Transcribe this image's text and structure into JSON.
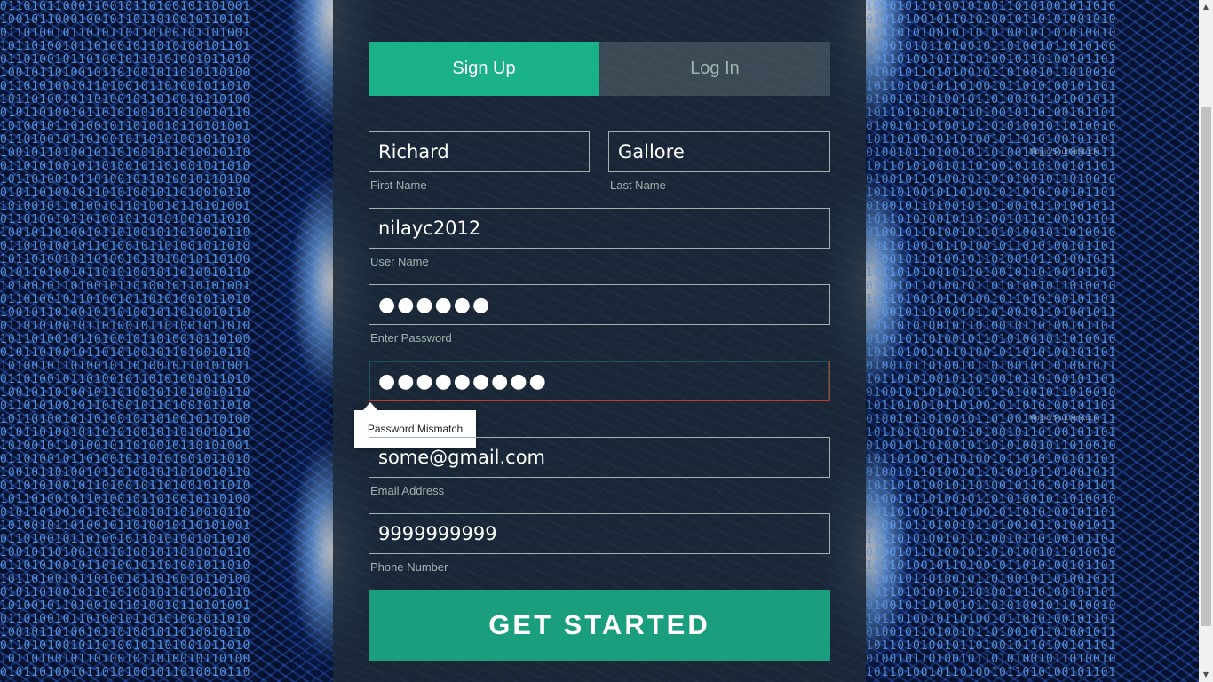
{
  "tabs": [
    {
      "label": "Sign Up",
      "active": true
    },
    {
      "label": "Log In",
      "active": false
    }
  ],
  "fields": {
    "first_name": {
      "value": "Richard",
      "label": "First Name"
    },
    "last_name": {
      "value": "Gallore",
      "label": "Last Name"
    },
    "user_name": {
      "value": "nilayc2012",
      "label": "User Name"
    },
    "password": {
      "value": "●●●●●●",
      "label": "Enter Password"
    },
    "confirm_password": {
      "value": "●●●●●●●●●"
    },
    "email": {
      "value": "some@gmail.com",
      "label": "Email Address"
    },
    "phone": {
      "value": "9999999999",
      "label": "Phone Number"
    }
  },
  "tooltip": {
    "text": "Password Mismatch"
  },
  "submit": {
    "label": "GET STARTED"
  },
  "watermarks": [
    "Mopic/Shutterstock",
    "Mopic/Shutterstock"
  ],
  "colors": {
    "accent": "#1ab188",
    "button": "#1a9e7d",
    "panel": "#1b2836",
    "muted_text": "#a0b3b0",
    "error": "#c0392b"
  }
}
